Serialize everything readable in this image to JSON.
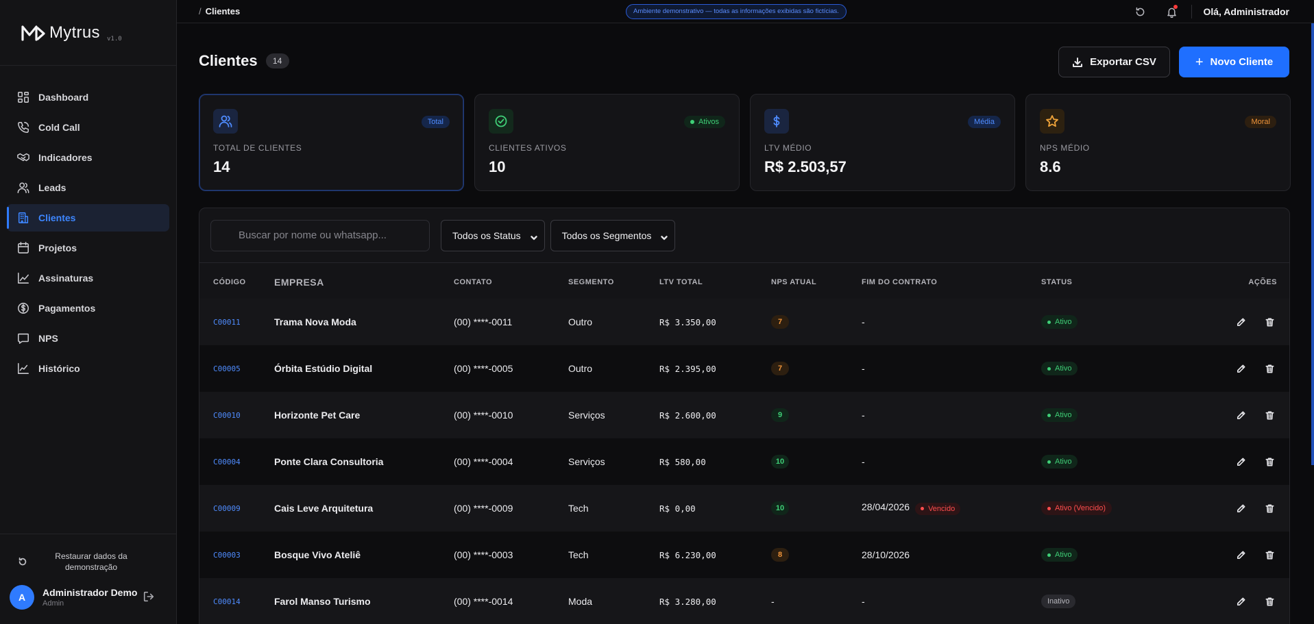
{
  "brand": {
    "name": "Mytrus",
    "version": "v1.0"
  },
  "sidebar": {
    "items": [
      {
        "label": "Dashboard",
        "icon": "dashboard-icon"
      },
      {
        "label": "Cold Call",
        "icon": "phone-icon"
      },
      {
        "label": "Indicadores",
        "icon": "handshake-icon"
      },
      {
        "label": "Leads",
        "icon": "users-icon"
      },
      {
        "label": "Clientes",
        "icon": "building-icon",
        "active": true
      },
      {
        "label": "Projetos",
        "icon": "calendar-icon"
      },
      {
        "label": "Assinaturas",
        "icon": "trend-icon"
      },
      {
        "label": "Pagamentos",
        "icon": "dollar-circle-icon"
      },
      {
        "label": "NPS",
        "icon": "chat-icon"
      },
      {
        "label": "Histórico",
        "icon": "history-chart-icon"
      }
    ],
    "restore_label": "Restaurar dados da demonstração",
    "user": {
      "initial": "A",
      "name": "Administrador Demo",
      "role": "Admin"
    }
  },
  "topbar": {
    "breadcrumb_sep": "/",
    "breadcrumb": "Clientes",
    "demo_notice": "Ambiente demonstrativo — todas as informações exibidas são fictícias.",
    "greeting": "Olá, Administrador"
  },
  "header": {
    "title": "Clientes",
    "count": "14",
    "export_label": "Exportar CSV",
    "new_label": "Novo Cliente",
    "new_plus": "+"
  },
  "cards": [
    {
      "label": "TOTAL DE CLIENTES",
      "value": "14",
      "tag": "Total"
    },
    {
      "label": "CLIENTES ATIVOS",
      "value": "10",
      "tag": "Ativos"
    },
    {
      "label": "LTV MÉDIO",
      "value": "R$ 2.503,57",
      "tag": "Média"
    },
    {
      "label": "NPS MÉDIO",
      "value": "8.6",
      "tag": "Moral"
    }
  ],
  "filters": {
    "search_placeholder": "Buscar por nome ou whatsapp...",
    "status_select": "Todos os Status",
    "segment_select": "Todos os Segmentos"
  },
  "table": {
    "headers": {
      "code": "CÓDIGO",
      "company": "EMPRESA",
      "contact": "CONTATO",
      "segment": "SEGMENTO",
      "ltv": "LTV TOTAL",
      "nps": "NPS ATUAL",
      "contract_end": "FIM DO CONTRATO",
      "status": "STATUS",
      "actions": "AÇÕES"
    },
    "rows": [
      {
        "code": "C00011",
        "company": "Trama Nova Moda",
        "contact": "(00) ****-0011",
        "segment": "Outro",
        "ltv": "R$ 3.350,00",
        "nps": "7",
        "contract_end": "-",
        "status": "Ativo"
      },
      {
        "code": "C00005",
        "company": "Órbita Estúdio Digital",
        "contact": "(00) ****-0005",
        "segment": "Outro",
        "ltv": "R$ 2.395,00",
        "nps": "7",
        "contract_end": "-",
        "status": "Ativo"
      },
      {
        "code": "C00010",
        "company": "Horizonte Pet Care",
        "contact": "(00) ****-0010",
        "segment": "Serviços",
        "ltv": "R$ 2.600,00",
        "nps": "9",
        "contract_end": "-",
        "status": "Ativo"
      },
      {
        "code": "C00004",
        "company": "Ponte Clara Consultoria",
        "contact": "(00) ****-0004",
        "segment": "Serviços",
        "ltv": "R$ 580,00",
        "nps": "10",
        "contract_end": "-",
        "status": "Ativo"
      },
      {
        "code": "C00009",
        "company": "Cais Leve Arquitetura",
        "contact": "(00) ****-0009",
        "segment": "Tech",
        "ltv": "R$ 0,00",
        "nps": "10",
        "contract_end": "28/04/2026",
        "contract_flag": "Vencido",
        "status": "Ativo (Vencido)"
      },
      {
        "code": "C00003",
        "company": "Bosque Vivo Ateliê",
        "contact": "(00) ****-0003",
        "segment": "Tech",
        "ltv": "R$ 6.230,00",
        "nps": "8",
        "contract_end": "28/10/2026",
        "status": "Ativo"
      },
      {
        "code": "C00014",
        "company": "Farol Manso Turismo",
        "contact": "(00) ****-0014",
        "segment": "Moda",
        "ltv": "R$ 3.280,00",
        "nps": "-",
        "contract_end": "-",
        "status": "Inativo"
      }
    ]
  },
  "colors": {
    "accent": "#1f6fff",
    "active_green": "#3fcf77",
    "danger": "#ff4d4d",
    "warning": "#f0943a"
  }
}
